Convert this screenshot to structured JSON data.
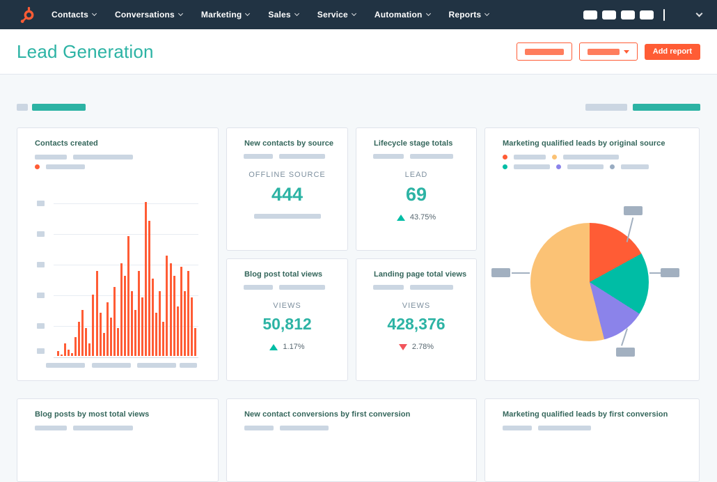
{
  "colors": {
    "nav_bg": "#213343",
    "accent_orange": "#ff5c35",
    "accent_teal": "#2cb3a4",
    "positive_teal": "#00bda5",
    "negative_red": "#f2545b",
    "page_bg": "#f5f8fa",
    "card_border": "#dfe3eb",
    "card_title": "#33655a",
    "muted_text": "#7d8f9e",
    "delta_text": "#56666f",
    "placeholder_gray": "#cbd6e2",
    "callout_gray": "#a2b0c0",
    "grid_line": "#e7ecf2",
    "axis_line": "#d3dbe4"
  },
  "nav": {
    "items": [
      {
        "label": "Contacts"
      },
      {
        "label": "Conversations"
      },
      {
        "label": "Marketing"
      },
      {
        "label": "Sales"
      },
      {
        "label": "Service"
      },
      {
        "label": "Automation"
      },
      {
        "label": "Reports"
      }
    ]
  },
  "header": {
    "title": "Lead Generation",
    "add_report_label": "Add report"
  },
  "cards": {
    "contacts_created": {
      "title": "Contacts created"
    },
    "new_contacts_by_source": {
      "title": "New contacts by source",
      "metric_label": "OFFLINE SOURCE",
      "metric_value": "444"
    },
    "lifecycle_stage_totals": {
      "title": "Lifecycle stage totals",
      "metric_label": "LEAD",
      "metric_value": "69",
      "delta": "43.75%",
      "delta_direction": "up"
    },
    "mql_by_original_source": {
      "title": "Marketing qualified leads by original source"
    },
    "blog_post_total_views": {
      "title": "Blog post total views",
      "metric_label": "VIEWS",
      "metric_value": "50,812",
      "delta": "1.17%",
      "delta_direction": "up"
    },
    "landing_page_total_views": {
      "title": "Landing page total views",
      "metric_label": "VIEWS",
      "metric_value": "428,376",
      "delta": "2.78%",
      "delta_direction": "down"
    },
    "blog_posts_by_most_total_views": {
      "title": "Blog posts by most total views"
    },
    "new_contact_conversions_by_first_conversion": {
      "title": "New contact conversions by first conversion"
    },
    "mql_by_first_conversion": {
      "title": "Marketing qualified leads by first conversion"
    }
  },
  "chart_data": [
    {
      "type": "bar",
      "title": "Contacts created",
      "xlabel": "",
      "ylabel": "",
      "ylim": [
        0,
        100
      ],
      "bar_color": "#ff5c35",
      "values": [
        3,
        1,
        8,
        4,
        2,
        12,
        22,
        30,
        18,
        8,
        40,
        55,
        28,
        15,
        35,
        25,
        45,
        18,
        60,
        52,
        78,
        42,
        30,
        55,
        38,
        100,
        88,
        50,
        28,
        42,
        22,
        65,
        60,
        52,
        32,
        58,
        42,
        55,
        38,
        18
      ]
    },
    {
      "type": "pie",
      "title": "Marketing qualified leads by original source",
      "slices": [
        {
          "name": "slice-1",
          "color": "#ff5c35",
          "value": 17
        },
        {
          "name": "slice-2",
          "color": "#00bda5",
          "value": 17
        },
        {
          "name": "slice-3",
          "color": "#8b83ea",
          "value": 12
        },
        {
          "name": "slice-4",
          "color": "#fbc275",
          "value": 54
        }
      ],
      "legend_colors": [
        "#ff5c35",
        "#fbc275",
        "#00bda5",
        "#8b83ea",
        "#99acc2"
      ]
    }
  ]
}
